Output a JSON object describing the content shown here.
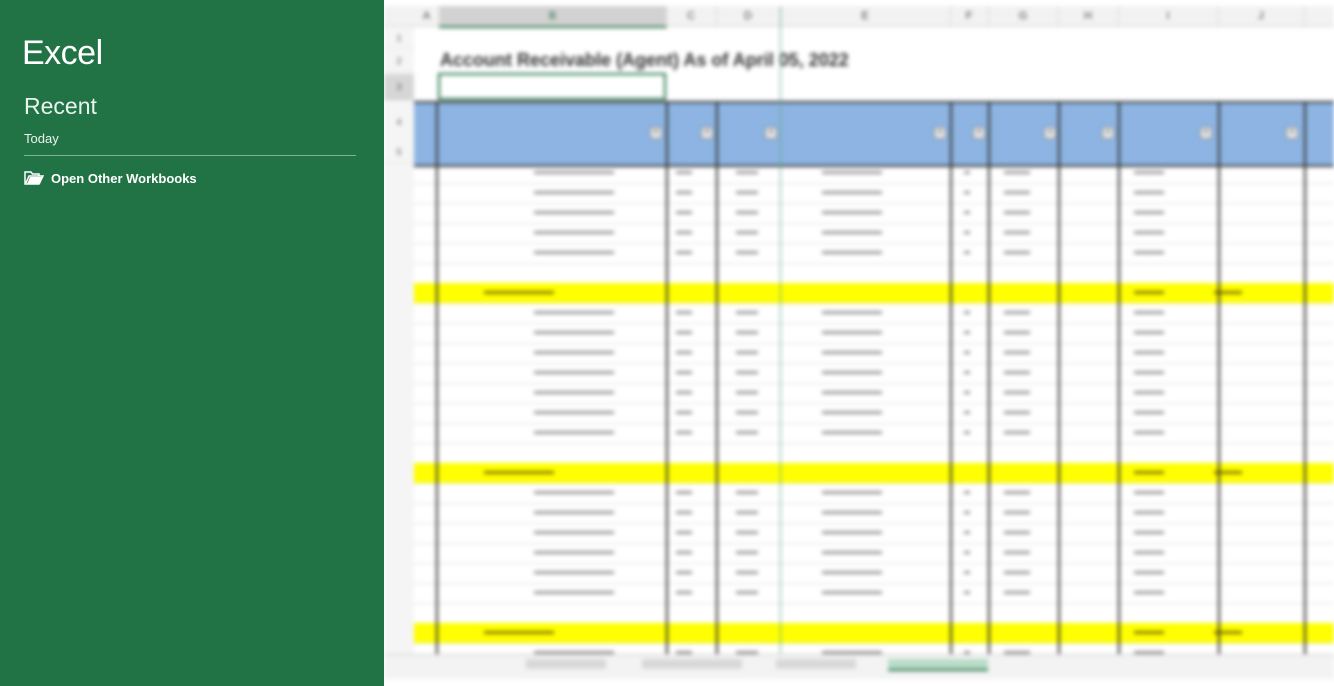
{
  "app": {
    "title": "Excel",
    "brand_color": "#217346"
  },
  "backstage": {
    "section_title": "Recent",
    "group_label": "Today",
    "open_other": {
      "label": "Open Other Workbooks",
      "icon": "folder-open-icon"
    }
  },
  "sheet": {
    "columns": [
      "A",
      "B",
      "C",
      "D",
      "E",
      "F",
      "G",
      "H",
      "I",
      "J"
    ],
    "top_row_numbers": [
      "1",
      "2",
      "3",
      "4",
      "5"
    ],
    "title": "Account Receivable (Agent) As of April 05, 2022",
    "highlight_color": "#ffff00",
    "header_color": "#8db4e2"
  }
}
